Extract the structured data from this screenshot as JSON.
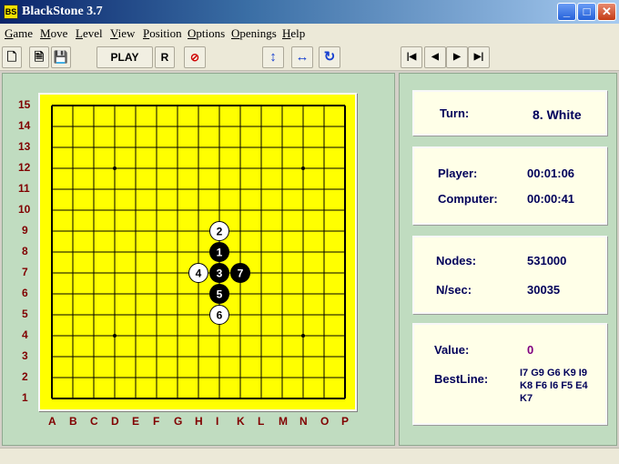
{
  "window": {
    "title": "BlackStone 3.7",
    "app_icon": "BS"
  },
  "menu": [
    "Game",
    "Move",
    "Level",
    "View",
    "Position",
    "Options",
    "Openings",
    "Help"
  ],
  "toolbar": {
    "play_label": "PLAY",
    "r_label": "R"
  },
  "board": {
    "size": 15,
    "background": "#ffff00",
    "row_labels": [
      "15",
      "14",
      "13",
      "12",
      "11",
      "10",
      "9",
      "8",
      "7",
      "6",
      "5",
      "4",
      "3",
      "2",
      "1"
    ],
    "col_labels": [
      "A",
      "B",
      "C",
      "D",
      "E",
      "F",
      "G",
      "H",
      "I",
      "K",
      "L",
      "M",
      "N",
      "O",
      "P"
    ],
    "star_points": [
      [
        3,
        12
      ],
      [
        12,
        12
      ],
      [
        3,
        4
      ],
      [
        12,
        4
      ]
    ],
    "stones": [
      {
        "num": "1",
        "color": "black",
        "col": 8,
        "row": 8
      },
      {
        "num": "2",
        "color": "white",
        "col": 8,
        "row": 9
      },
      {
        "num": "3",
        "color": "black",
        "col": 8,
        "row": 7
      },
      {
        "num": "4",
        "color": "white",
        "col": 7,
        "row": 7
      },
      {
        "num": "5",
        "color": "black",
        "col": 8,
        "row": 6
      },
      {
        "num": "6",
        "color": "white",
        "col": 8,
        "row": 5
      },
      {
        "num": "7",
        "color": "black",
        "col": 9,
        "row": 7
      }
    ]
  },
  "info": {
    "turn_label": "Turn:",
    "turn_value": "8. White",
    "player_label": "Player:",
    "player_time": "00:01:06",
    "computer_label": "Computer:",
    "computer_time": "00:00:41",
    "nodes_label": "Nodes:",
    "nodes_value": "531000",
    "nsec_label": "N/sec:",
    "nsec_value": "30035",
    "value_label": "Value:",
    "value_value": "0",
    "bestline_label": "BestLine:",
    "bestline_value": "I7 G9 G6 K9 I9 K8 F6 I6 F5 E4 K7"
  }
}
